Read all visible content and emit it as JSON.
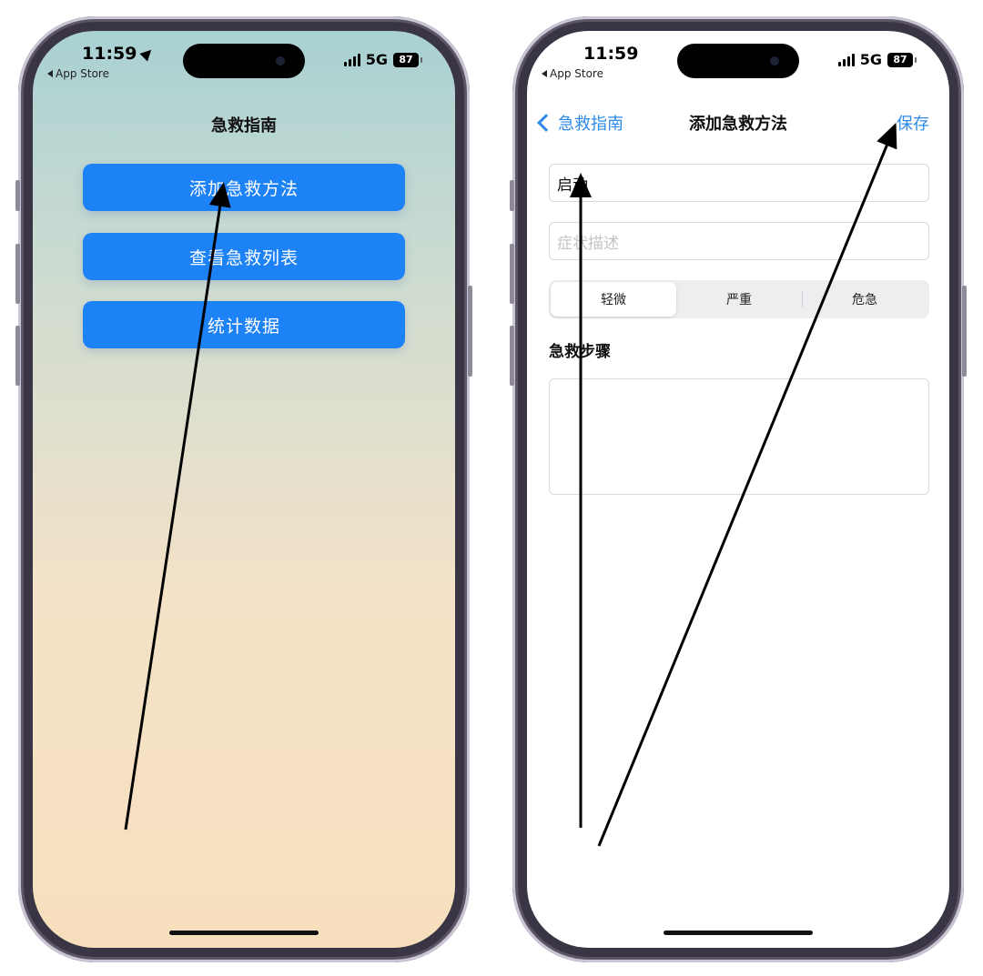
{
  "status_bar": {
    "time": "11:59",
    "back_app": "App Store",
    "network": "5G",
    "battery": "87"
  },
  "home_screen": {
    "title": "急救指南",
    "buttons": [
      {
        "label": "添加急救方法"
      },
      {
        "label": "查看急救列表"
      },
      {
        "label": "统计数据"
      }
    ]
  },
  "form_screen": {
    "nav": {
      "back_label": "急救指南",
      "title": "添加急救方法",
      "save_label": "保存"
    },
    "name_field": {
      "value": "启动"
    },
    "symptom_field": {
      "placeholder": "症状描述"
    },
    "severity": {
      "options": [
        "轻微",
        "严重",
        "危急"
      ],
      "selected": "轻微"
    },
    "steps_label": "急救步骤",
    "steps_value": ""
  },
  "colors": {
    "button_blue": "#1e82f7",
    "link_blue": "#2e8aea",
    "arrow": "#000000"
  },
  "icons": [
    "location-arrow-icon",
    "back-triangle-icon",
    "signal-bars-icon",
    "battery-icon",
    "chevron-left-icon"
  ]
}
